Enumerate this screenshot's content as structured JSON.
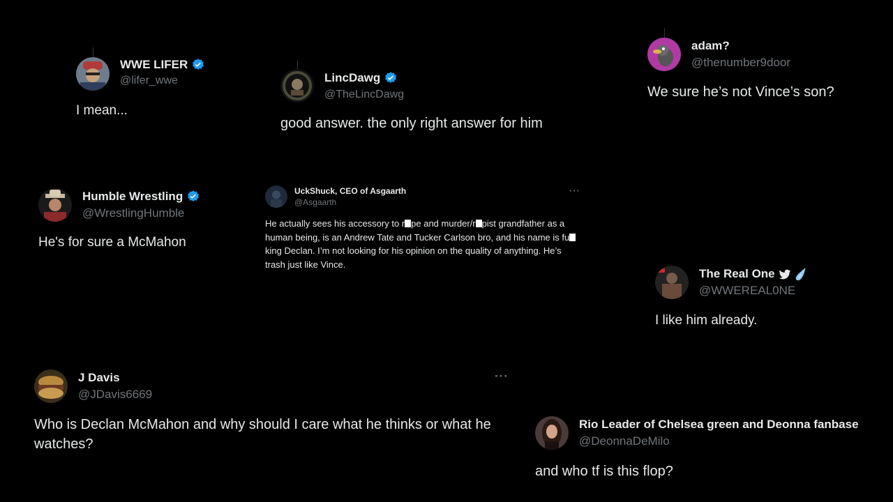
{
  "tweets": [
    {
      "name": "WWE LIFER",
      "handle": "@lifer_wwe",
      "text": "I mean...",
      "verified": true,
      "avatar_icon": "man-with-cap-avatar-icon"
    },
    {
      "name": "LincDawg",
      "handle": "@TheLincDawg",
      "text": "good answer. the only right answer for him",
      "verified": true,
      "avatar_icon": "portrait-circle-avatar-icon"
    },
    {
      "name": "adam?",
      "handle": "@thenumber9door",
      "text": "We sure he’s not Vince’s son?",
      "verified": false,
      "avatar_icon": "cartoon-avatar-icon"
    },
    {
      "name": "Humble Wrestling",
      "handle": "@WrestlingHumble",
      "text": "He's for sure a McMahon",
      "verified": true,
      "avatar_icon": "cowboy-hat-avatar-icon"
    },
    {
      "name": "UckShuck, CEO of Asgaarth",
      "handle": "@Asgaarth",
      "text_parts": [
        "He actually sees his accessory to r",
        "pe and murder/r",
        "pist grandfather as a human being, is an Andrew Tate and Tucker Carlson bro, and his name is fu",
        "king Declan. I’m not looking for his opinion on the quality of anything. He’s trash just like Vince."
      ],
      "verified": false,
      "more_label": "···",
      "avatar_icon": "dark-figure-avatar-icon"
    },
    {
      "name": "The Real One",
      "handle": "@WWEREAL0NE",
      "text": "I like him already.",
      "verified": false,
      "name_emojis": [
        "bird-icon",
        "droplet-icon"
      ],
      "avatar_icon": "wrestler-avatar-icon"
    },
    {
      "name": "J Davis",
      "handle": "@JDavis6669",
      "text": "Who is Declan McMahon and why should I care what he thinks or what he watches?",
      "verified": false,
      "more_label": "···",
      "avatar_icon": "food-avatar-icon"
    },
    {
      "name": "Rio Leader of Chelsea green and Deonna fanbase",
      "handle": "@DeonnaDeMilo",
      "text": "and who tf is this flop?",
      "verified": false,
      "avatar_icon": "woman-portrait-avatar-icon"
    }
  ],
  "colors": {
    "background": "#000000",
    "text": "#e7e9ea",
    "handle": "#71767b",
    "verified": "#1d9bf0"
  }
}
